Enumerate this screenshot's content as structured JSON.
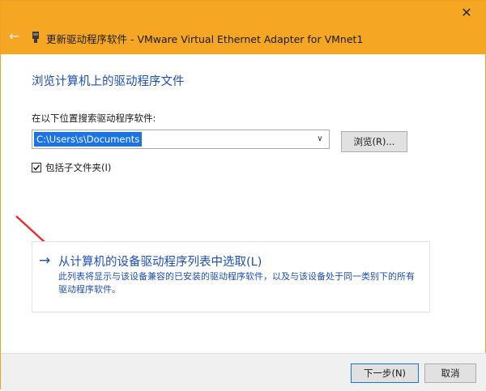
{
  "window": {
    "title": "更新驱动程序软件 - VMware Virtual Ethernet Adapter for VMnet1",
    "close_glyph": "✕",
    "back_glyph": "←",
    "accent_color": "#f5a623"
  },
  "content": {
    "heading": "浏览计算机上的驱动程序文件",
    "search_label": "在以下位置搜索驱动程序软件:",
    "search_path": "C:\\Users\\s\\Documents",
    "dropdown_glyph": "∨",
    "browse_label": "浏览(R)...",
    "include_subfolders_label": "包括子文件夹(I)",
    "include_subfolders_checked": true
  },
  "pick_option": {
    "arrow_glyph": "→",
    "title": "从计算机的设备驱动程序列表中选取(L)",
    "description": "此列表将显示与该设备兼容的已安装的驱动程序软件，以及与该设备处于同一类别下的所有驱动程序软件。",
    "link_color": "#1e4fb6"
  },
  "annotation": {
    "arrow_color": "#e8312f"
  },
  "footer": {
    "next_label": "下一步(N)",
    "cancel_label": "取消"
  },
  "icons": [
    "back-arrow-icon",
    "device-icon",
    "close-icon",
    "chevron-down-icon",
    "checkmark-icon",
    "right-arrow-icon",
    "red-pointer-arrow-icon"
  ]
}
